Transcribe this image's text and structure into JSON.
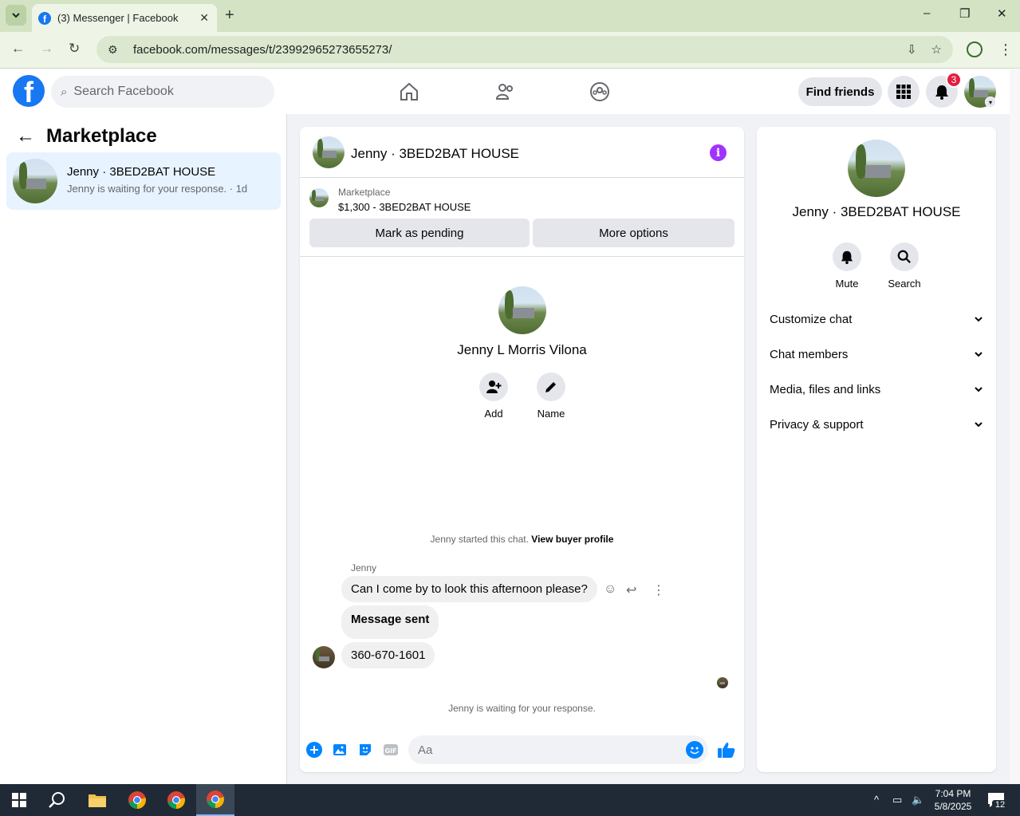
{
  "browser": {
    "tab_title": "(3) Messenger | Facebook",
    "url": "facebook.com/messages/t/23992965273655273/",
    "window_controls": [
      "–",
      "❐",
      "✕"
    ]
  },
  "topbar": {
    "search_placeholder": "Search Facebook",
    "find_friends": "Find friends",
    "notification_count": "3",
    "brand_color": "#1877f2"
  },
  "left": {
    "title": "Marketplace",
    "conversation": {
      "name": "Jenny · 3BED2BAT HOUSE",
      "snippet": "Jenny is waiting for your response. · 1d"
    }
  },
  "chat": {
    "header_name": "Jenny · 3BED2BAT HOUSE",
    "marketplace_label": "Marketplace",
    "listing": "$1,300 - 3BED2BAT HOUSE",
    "mark_pending": "Mark as pending",
    "more_options": "More options",
    "profile_name": "Jenny L Morris Vilona",
    "actions": [
      {
        "label": "Add"
      },
      {
        "label": "Name"
      }
    ],
    "started_text": "Jenny started this chat.",
    "view_buyer": "View buyer profile",
    "sender": "Jenny",
    "messages": [
      {
        "text": "Can I come by to look this afternoon please?"
      },
      {
        "text": "Message sent"
      },
      {
        "text": "360-670-1601"
      }
    ],
    "waiting_text": "Jenny is waiting for your response.",
    "composer_placeholder": "Aa"
  },
  "right_panel": {
    "name": "Jenny · 3BED2BAT HOUSE",
    "actions": [
      {
        "label": "Mute"
      },
      {
        "label": "Search"
      }
    ],
    "sections": [
      {
        "label": "Customize chat"
      },
      {
        "label": "Chat members"
      },
      {
        "label": "Media, files and links"
      },
      {
        "label": "Privacy & support"
      }
    ]
  },
  "taskbar": {
    "time": "7:04 PM",
    "date": "5/8/2025",
    "notification_count": "12"
  }
}
